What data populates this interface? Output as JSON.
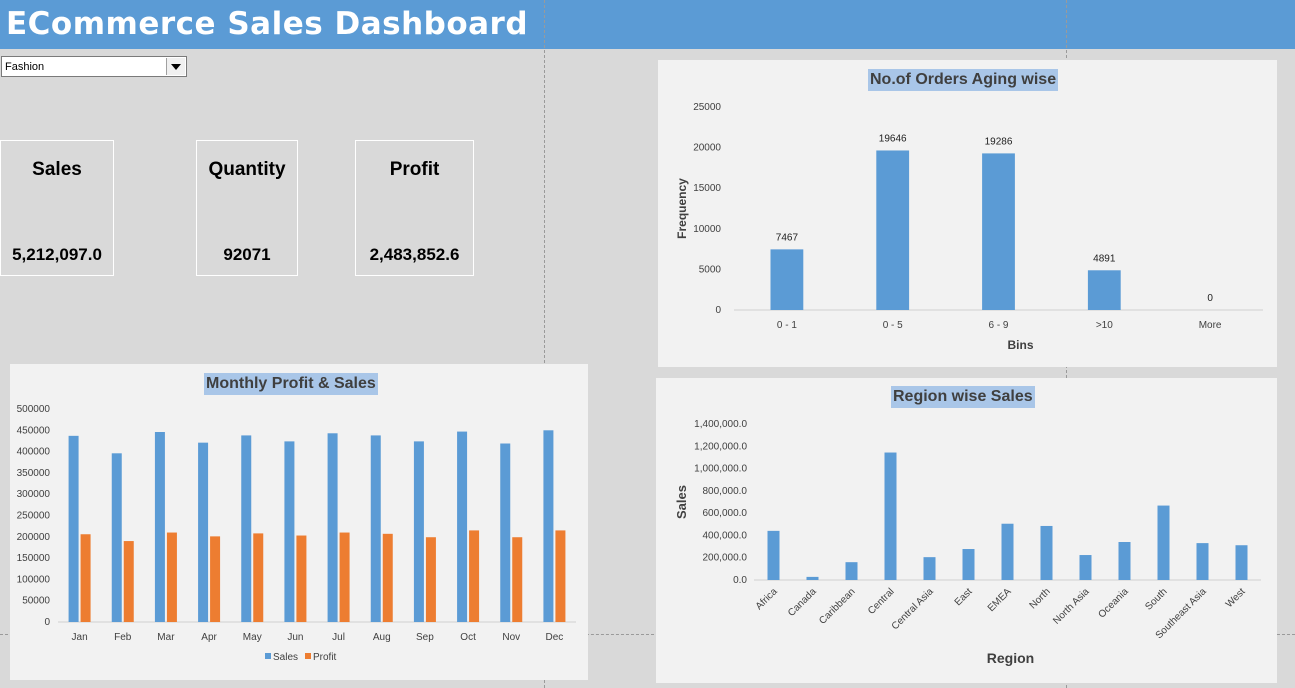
{
  "dashboard": {
    "title": "ECommerce Sales Dashboard",
    "filter": {
      "selected": "Fashion"
    }
  },
  "kpis": {
    "sales": {
      "label": "Sales",
      "value": "5,212,097.0"
    },
    "quantity": {
      "label": "Quantity",
      "value": "92071"
    },
    "profit": {
      "label": "Profit",
      "value": "2,483,852.6"
    }
  },
  "colors": {
    "header": "#5b9bd5",
    "sales": "#5b9bd5",
    "profit": "#ed7d31",
    "title_bg": "#a9c6e8"
  },
  "chart_data": [
    {
      "id": "orders-aging",
      "type": "bar",
      "title": "No.of Orders Aging wise",
      "xlabel": "Bins",
      "ylabel": "Frequency",
      "categories": [
        "0 - 1",
        "0 - 5",
        "6 - 9",
        ">10",
        "More"
      ],
      "values": [
        7467,
        19646,
        19286,
        4891,
        0
      ],
      "data_labels": true,
      "ylim": [
        0,
        25000
      ],
      "yticks": [
        0,
        5000,
        10000,
        15000,
        20000,
        25000
      ],
      "ytick_labels": [
        "0",
        "5000",
        "10000",
        "15000",
        "20000",
        "25000"
      ],
      "grid": false
    },
    {
      "id": "monthly-profit-sales",
      "type": "bar",
      "title": "Monthly Profit & Sales",
      "xlabel": "",
      "ylabel": "",
      "categories": [
        "Jan",
        "Feb",
        "Mar",
        "Apr",
        "May",
        "Jun",
        "Jul",
        "Aug",
        "Sep",
        "Oct",
        "Nov",
        "Dec"
      ],
      "series": [
        {
          "name": "Sales",
          "color": "#5b9bd5",
          "values": [
            437000,
            396000,
            446000,
            421000,
            438000,
            424000,
            443000,
            438000,
            424000,
            447000,
            419000,
            450000
          ]
        },
        {
          "name": "Profit",
          "color": "#ed7d31",
          "values": [
            206000,
            190000,
            210000,
            201000,
            208000,
            203000,
            210000,
            207000,
            199000,
            215000,
            199000,
            215000
          ]
        }
      ],
      "ylim": [
        0,
        500000
      ],
      "yticks": [
        0,
        50000,
        100000,
        150000,
        200000,
        250000,
        300000,
        350000,
        400000,
        450000,
        500000
      ],
      "ytick_labels": [
        "0",
        "50000",
        "100000",
        "150000",
        "200000",
        "250000",
        "300000",
        "350000",
        "400000",
        "450000",
        "500000"
      ],
      "legend": "bottom",
      "grid": false
    },
    {
      "id": "region-sales",
      "type": "bar",
      "title": "Region wise Sales",
      "xlabel": "Region",
      "ylabel": "Sales",
      "categories": [
        "Africa",
        "Canada",
        "Caribbean",
        "Central",
        "Central Asia",
        "East",
        "EMEA",
        "North",
        "North Asia",
        "Oceania",
        "South",
        "Southeast Asia",
        "West"
      ],
      "values": [
        441000,
        28000,
        160000,
        1144000,
        205000,
        278000,
        505000,
        485000,
        224000,
        341000,
        668000,
        331000,
        312000
      ],
      "ylim": [
        0,
        1400000
      ],
      "yticks": [
        0,
        200000,
        400000,
        600000,
        800000,
        1000000,
        1200000,
        1400000
      ],
      "ytick_labels": [
        "0.0",
        "200,000.0",
        "400,000.0",
        "600,000.0",
        "800,000.0",
        "1,000,000.0",
        "1,200,000.0",
        "1,400,000.0"
      ],
      "grid": false
    }
  ]
}
